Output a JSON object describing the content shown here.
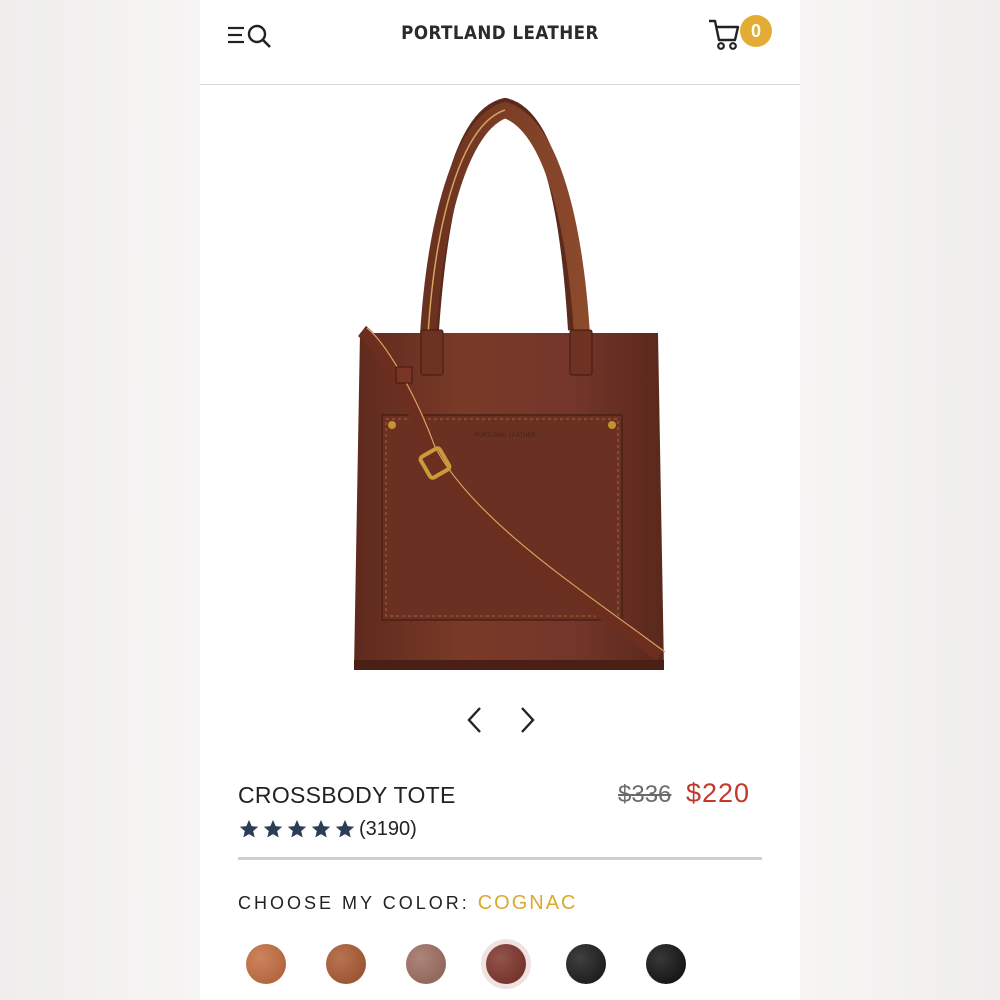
{
  "header": {
    "brand": "PORTLAND LEATHER",
    "cart_count": "0",
    "menu_icon": "menu-search-icon",
    "cart_icon": "cart-icon"
  },
  "gallery": {
    "image_alt": "Crossbody tote leather bag",
    "prev_icon": "chevron-left-icon",
    "next_icon": "chevron-right-icon"
  },
  "product": {
    "title": "CROSSBODY TOTE",
    "original_price": "$336",
    "sale_price": "$220",
    "rating_stars": 5,
    "review_count": "(3190)"
  },
  "color_picker": {
    "label": "CHOOSE MY COLOR:",
    "selected": "COGNAC",
    "swatches": [
      {
        "color": "#c1693a"
      },
      {
        "color": "#a8552c"
      },
      {
        "color": "#9b6a5c"
      },
      {
        "color": "#7a2e25"
      },
      {
        "color": "#151515"
      },
      {
        "color": "#0c0c0c"
      }
    ]
  },
  "colors": {
    "accent": "#e3ad35",
    "sale": "#c0392b",
    "star": "#2c3e55"
  }
}
